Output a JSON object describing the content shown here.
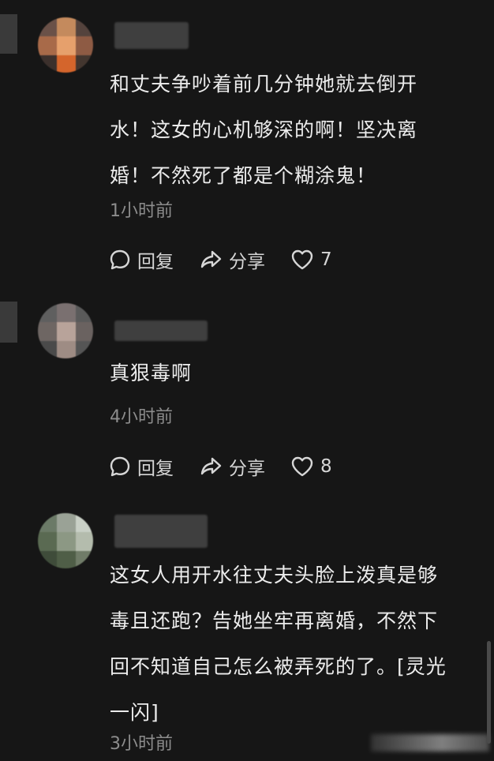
{
  "comments": [
    {
      "text": "和丈夫争吵着前几分钟她就去倒开水！这女的心机够深的啊！坚决离婚！不然死了都是个糊涂鬼！",
      "time": "1小时前",
      "reply_label": "回复",
      "share_label": "分享",
      "likes": "7"
    },
    {
      "text": "真狠毒啊",
      "time": "4小时前",
      "reply_label": "回复",
      "share_label": "分享",
      "likes": "8"
    },
    {
      "text": "这女人用开水往丈夫头脸上泼真是够毒且还跑？告她坐牢再离婚，不然下回不知道自己怎么被弄死的了。[灵光一闪]",
      "time": "3小时前"
    }
  ],
  "icons": {
    "reply": "comment-bubble-icon",
    "share": "share-arrow-icon",
    "like": "heart-icon"
  },
  "colors": {
    "background": "#161616",
    "text": "#ececec",
    "muted": "#8c8c8c"
  }
}
